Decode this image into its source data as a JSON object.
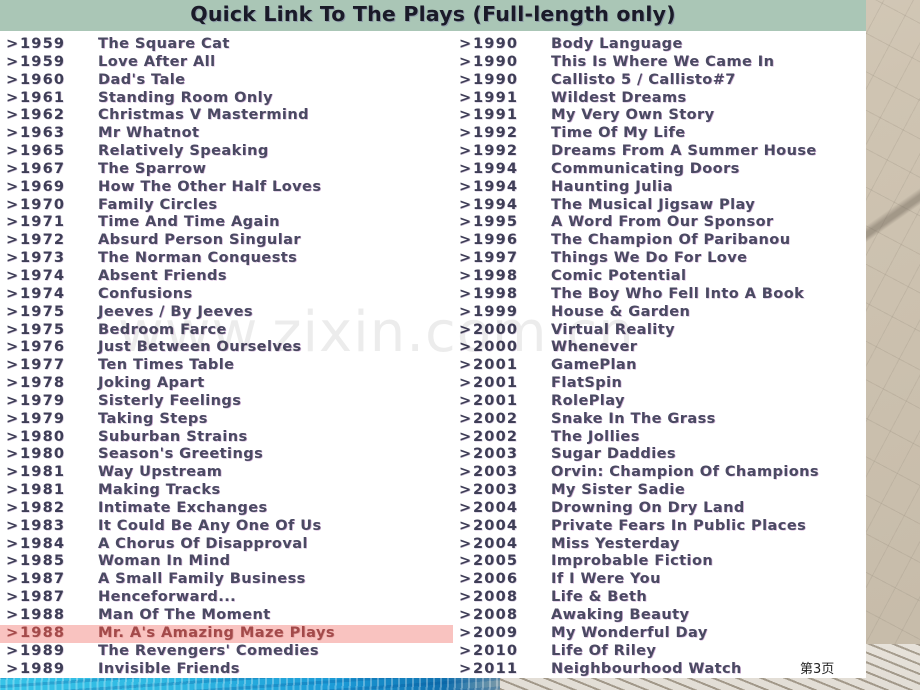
{
  "slide": {
    "title": "Quick Link To The Plays (Full-length only)",
    "watermark": "www.zixin.com.cn",
    "page_number": "第3页",
    "bullet_glyph": ">",
    "colors": {
      "title_bar": "#aac6b6",
      "highlight_row": "#f9c3c0",
      "text": "#4a4a62",
      "highlight_text": "#a34a4a",
      "card": "#ffffff"
    }
  },
  "columns": {
    "left": [
      {
        "year": "1959",
        "title": "The Square Cat",
        "highlight": false
      },
      {
        "year": "1959",
        "title": "Love After All",
        "highlight": false
      },
      {
        "year": "1960",
        "title": "Dad's Tale",
        "highlight": false
      },
      {
        "year": "1961",
        "title": "Standing Room Only",
        "highlight": false
      },
      {
        "year": "1962",
        "title": "Christmas V Mastermind",
        "highlight": false
      },
      {
        "year": "1963",
        "title": "Mr Whatnot",
        "highlight": false
      },
      {
        "year": "1965",
        "title": "Relatively Speaking",
        "highlight": false
      },
      {
        "year": "1967",
        "title": "The Sparrow",
        "highlight": false
      },
      {
        "year": "1969",
        "title": "How The Other Half Loves",
        "highlight": false
      },
      {
        "year": "1970",
        "title": "Family Circles",
        "highlight": false
      },
      {
        "year": "1971",
        "title": "Time And Time Again",
        "highlight": false
      },
      {
        "year": "1972",
        "title": "Absurd Person Singular",
        "highlight": false
      },
      {
        "year": "1973",
        "title": "The Norman Conquests",
        "highlight": false
      },
      {
        "year": "1974",
        "title": "Absent Friends",
        "highlight": false
      },
      {
        "year": "1974",
        "title": "Confusions",
        "highlight": false
      },
      {
        "year": "1975",
        "title": "Jeeves / By Jeeves",
        "highlight": false
      },
      {
        "year": "1975",
        "title": "Bedroom Farce",
        "highlight": false
      },
      {
        "year": "1976",
        "title": "Just Between Ourselves",
        "highlight": false
      },
      {
        "year": "1977",
        "title": "Ten Times Table",
        "highlight": false
      },
      {
        "year": "1978",
        "title": "Joking Apart",
        "highlight": false
      },
      {
        "year": "1979",
        "title": "Sisterly Feelings",
        "highlight": false
      },
      {
        "year": "1979",
        "title": "Taking Steps",
        "highlight": false
      },
      {
        "year": "1980",
        "title": "Suburban Strains",
        "highlight": false
      },
      {
        "year": "1980",
        "title": "Season's Greetings",
        "highlight": false
      },
      {
        "year": "1981",
        "title": "Way Upstream",
        "highlight": false
      },
      {
        "year": "1981",
        "title": "Making Tracks",
        "highlight": false
      },
      {
        "year": "1982",
        "title": "Intimate Exchanges",
        "highlight": false
      },
      {
        "year": "1983",
        "title": "It Could Be Any One Of Us",
        "highlight": false
      },
      {
        "year": "1984",
        "title": "A Chorus Of Disapproval",
        "highlight": false
      },
      {
        "year": "1985",
        "title": "Woman In Mind",
        "highlight": false
      },
      {
        "year": "1987",
        "title": "A Small Family Business",
        "highlight": false
      },
      {
        "year": "1987",
        "title": "Henceforward...",
        "highlight": false
      },
      {
        "year": "1988",
        "title": "Man Of The Moment",
        "highlight": false
      },
      {
        "year": "1988",
        "title": "Mr. A's Amazing Maze Plays",
        "highlight": true
      },
      {
        "year": "1989",
        "title": "The Revengers' Comedies",
        "highlight": false
      },
      {
        "year": "1989",
        "title": "Invisible Friends",
        "highlight": false
      }
    ],
    "right": [
      {
        "year": "1990",
        "title": "Body Language",
        "highlight": false
      },
      {
        "year": "1990",
        "title": "This Is Where We Came In",
        "highlight": false
      },
      {
        "year": "1990",
        "title": "Callisto 5 / Callisto#7",
        "highlight": false
      },
      {
        "year": "1991",
        "title": "Wildest Dreams",
        "highlight": false
      },
      {
        "year": "1991",
        "title": "My Very Own Story",
        "highlight": false
      },
      {
        "year": "1992",
        "title": "Time Of My Life",
        "highlight": false
      },
      {
        "year": "1992",
        "title": "Dreams From A Summer House",
        "highlight": false
      },
      {
        "year": "1994",
        "title": "Communicating Doors",
        "highlight": false
      },
      {
        "year": "1994",
        "title": "Haunting Julia",
        "highlight": false
      },
      {
        "year": "1994",
        "title": "The Musical Jigsaw Play",
        "highlight": false
      },
      {
        "year": "1995",
        "title": "A Word From Our Sponsor",
        "highlight": false
      },
      {
        "year": "1996",
        "title": "The Champion Of Paribanou",
        "highlight": false
      },
      {
        "year": "1997",
        "title": "Things We Do For Love",
        "highlight": false
      },
      {
        "year": "1998",
        "title": "Comic Potential",
        "highlight": false
      },
      {
        "year": "1998",
        "title": "The Boy Who Fell Into A Book",
        "highlight": false
      },
      {
        "year": "1999",
        "title": "House & Garden",
        "highlight": false
      },
      {
        "year": "2000",
        "title": "Virtual Reality",
        "highlight": false
      },
      {
        "year": "2000",
        "title": "Whenever",
        "highlight": false
      },
      {
        "year": "2001",
        "title": "GamePlan",
        "highlight": false
      },
      {
        "year": "2001",
        "title": "FlatSpin",
        "highlight": false
      },
      {
        "year": "2001",
        "title": "RolePlay",
        "highlight": false
      },
      {
        "year": "2002",
        "title": "Snake In The Grass",
        "highlight": false
      },
      {
        "year": "2002",
        "title": "The Jollies",
        "highlight": false
      },
      {
        "year": "2003",
        "title": "Sugar Daddies",
        "highlight": false
      },
      {
        "year": "2003",
        "title": "Orvin: Champion Of Champions",
        "highlight": false
      },
      {
        "year": "2003",
        "title": "My Sister Sadie",
        "highlight": false
      },
      {
        "year": "2004",
        "title": "Drowning On Dry Land",
        "highlight": false
      },
      {
        "year": "2004",
        "title": "Private Fears In Public Places",
        "highlight": false
      },
      {
        "year": "2004",
        "title": "Miss Yesterday",
        "highlight": false
      },
      {
        "year": "2005",
        "title": "Improbable Fiction",
        "highlight": false
      },
      {
        "year": "2006",
        "title": "If I Were You",
        "highlight": false
      },
      {
        "year": "2008",
        "title": "Life & Beth",
        "highlight": false
      },
      {
        "year": "2008",
        "title": "Awaking Beauty",
        "highlight": false
      },
      {
        "year": "2009",
        "title": "My Wonderful Day",
        "highlight": false
      },
      {
        "year": "2010",
        "title": "Life Of Riley",
        "highlight": false
      },
      {
        "year": "2011",
        "title": "Neighbourhood Watch",
        "highlight": false
      }
    ]
  }
}
